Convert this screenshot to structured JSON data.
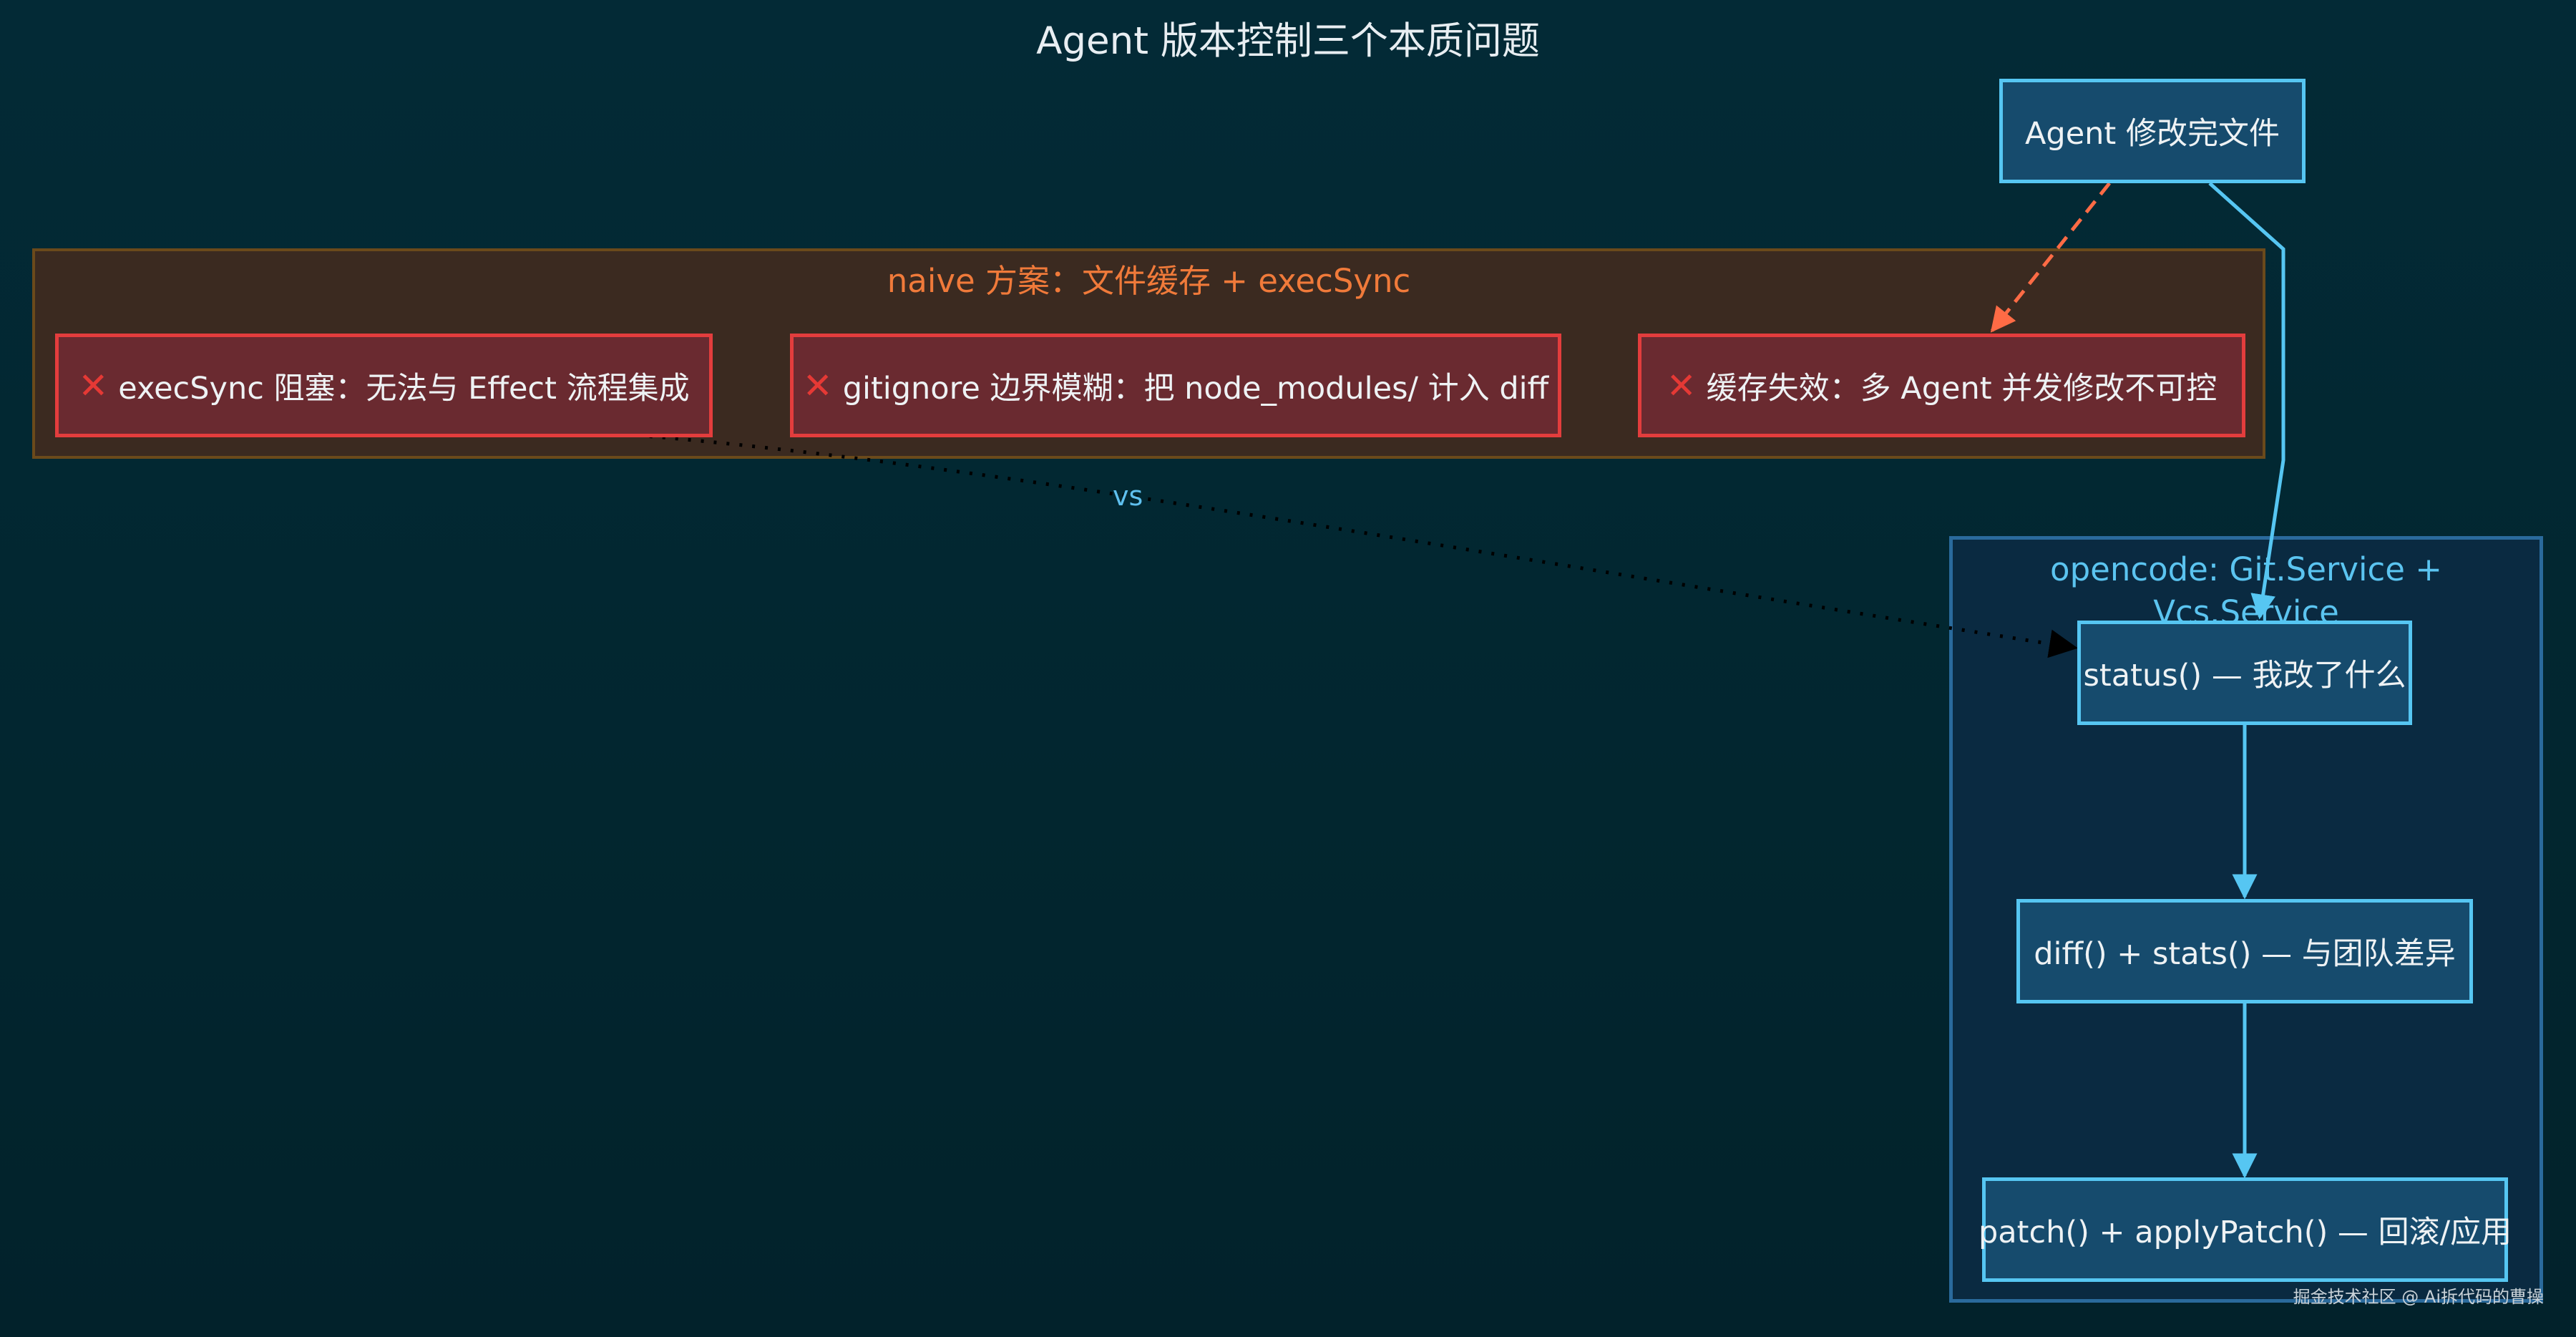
{
  "title": "Agent 版本控制三个本质问题",
  "colors": {
    "background": "#02252f",
    "naive_cluster_fill": "#3b2a20",
    "naive_cluster_border": "#6b4a1b",
    "naive_label": "#f07a3a",
    "bad_node_fill": "#6a2a30",
    "bad_node_border": "#e33d3d",
    "opencode_cluster_fill": "#0a2a41",
    "opencode_cluster_border": "#2a6a9c",
    "blue_node_fill": "#164b6d",
    "blue_node_border": "#56c6f2",
    "dashed_edge": "#ff6b45",
    "solid_edge": "#56c6f2",
    "dotted_edge": "#000000"
  },
  "nodes": {
    "agent": "Agent 修改完文件"
  },
  "naive": {
    "label": "naive 方案：文件缓存 + execSync",
    "problems": [
      {
        "icon": "cross-mark-icon",
        "mark": "✕",
        "text": "execSync 阻塞：无法与 Effect 流程集成"
      },
      {
        "icon": "cross-mark-icon",
        "mark": "✕",
        "text": "gitignore 边界模糊：把 node_modules/ 计入 diff"
      },
      {
        "icon": "cross-mark-icon",
        "mark": "✕",
        "text": "缓存失效：多 Agent 并发修改不可控"
      }
    ]
  },
  "opencode": {
    "label": "opencode: Git.Service + Vcs.Service",
    "steps": [
      "status() — 我改了什么",
      "diff() + stats() — 与团队差异",
      "patch() + applyPatch() — 回滚/应用"
    ]
  },
  "edges": {
    "vs_label": "vs"
  },
  "watermark": "掘金技术社区 @ Ai拆代码的曹操"
}
